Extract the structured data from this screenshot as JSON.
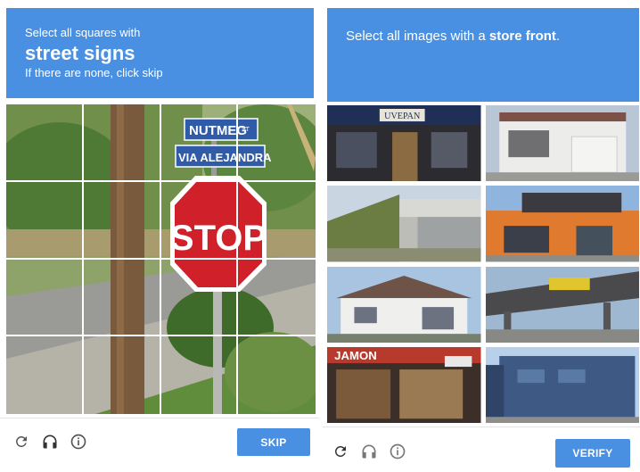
{
  "left_challenge": {
    "instruction_line1": "Select all squares with",
    "target": "street signs",
    "hint": "If there are none, click skip",
    "street_sign_top": "NUTMEG",
    "street_sign_top_suffix": "ST",
    "street_sign_bottom": "VIA ALEJANDRA",
    "stop_sign": "STOP",
    "skip_label": "SKIP",
    "grid_rows": 4,
    "grid_cols": 4
  },
  "right_challenge": {
    "instruction_prefix": "Select all images with a ",
    "target": "store front",
    "instruction_suffix": ".",
    "verify_label": "VERIFY",
    "tile_texts": {
      "tile1_sign": "UVEPAN",
      "tile7_sign": "JAMON"
    }
  },
  "footer": {
    "icons": [
      "reload-icon",
      "headphones-icon",
      "info-icon"
    ]
  },
  "colors": {
    "accent": "#4a90e2",
    "stop_red": "#d0202a",
    "street_sign_blue": "#2f5ba8"
  }
}
